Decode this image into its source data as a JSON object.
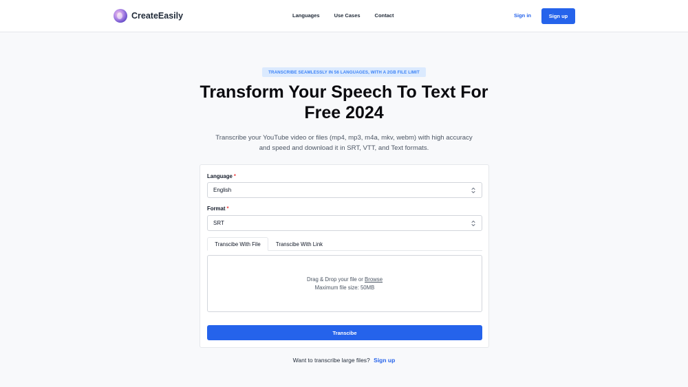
{
  "brand": {
    "name": "CreateEasily",
    "logo_icon": "gradient-orb-icon"
  },
  "nav": {
    "links": [
      "Languages",
      "Use Cases",
      "Contact"
    ],
    "sign_in": "Sign in",
    "sign_up": "Sign up"
  },
  "hero": {
    "badge": "TRANSCRIBE SEAMLESSLY IN 56 LANGUAGES, WITH A 2GB FILE LIMIT",
    "title_line1": "Transform Your Speech To Text For",
    "title_line2": "Free 2024",
    "desc_line1": "Transcribe your YouTube video or files (mp4, mp3, m4a, mkv, webm) with high accuracy",
    "desc_line2": "and speed and download it in SRT, VTT, and Text formats."
  },
  "form": {
    "language_label": "Language",
    "language_value": "English",
    "format_label": "Format",
    "format_value": "SRT",
    "required_mark": "*",
    "tabs": [
      "Transcibe With File",
      "Transcibe With Link"
    ],
    "active_tab": 0,
    "dropzone_text": "Drag & Drop your file or",
    "browse_label": "Browse",
    "max_size": "Maximum file size: 50MB",
    "submit": "Transcibe"
  },
  "footer": {
    "prompt": "Want to transcribe large files?",
    "link": "Sign up"
  },
  "colors": {
    "accent": "#2563eb",
    "badge_bg": "#dbeafe",
    "required": "#ef4444"
  }
}
